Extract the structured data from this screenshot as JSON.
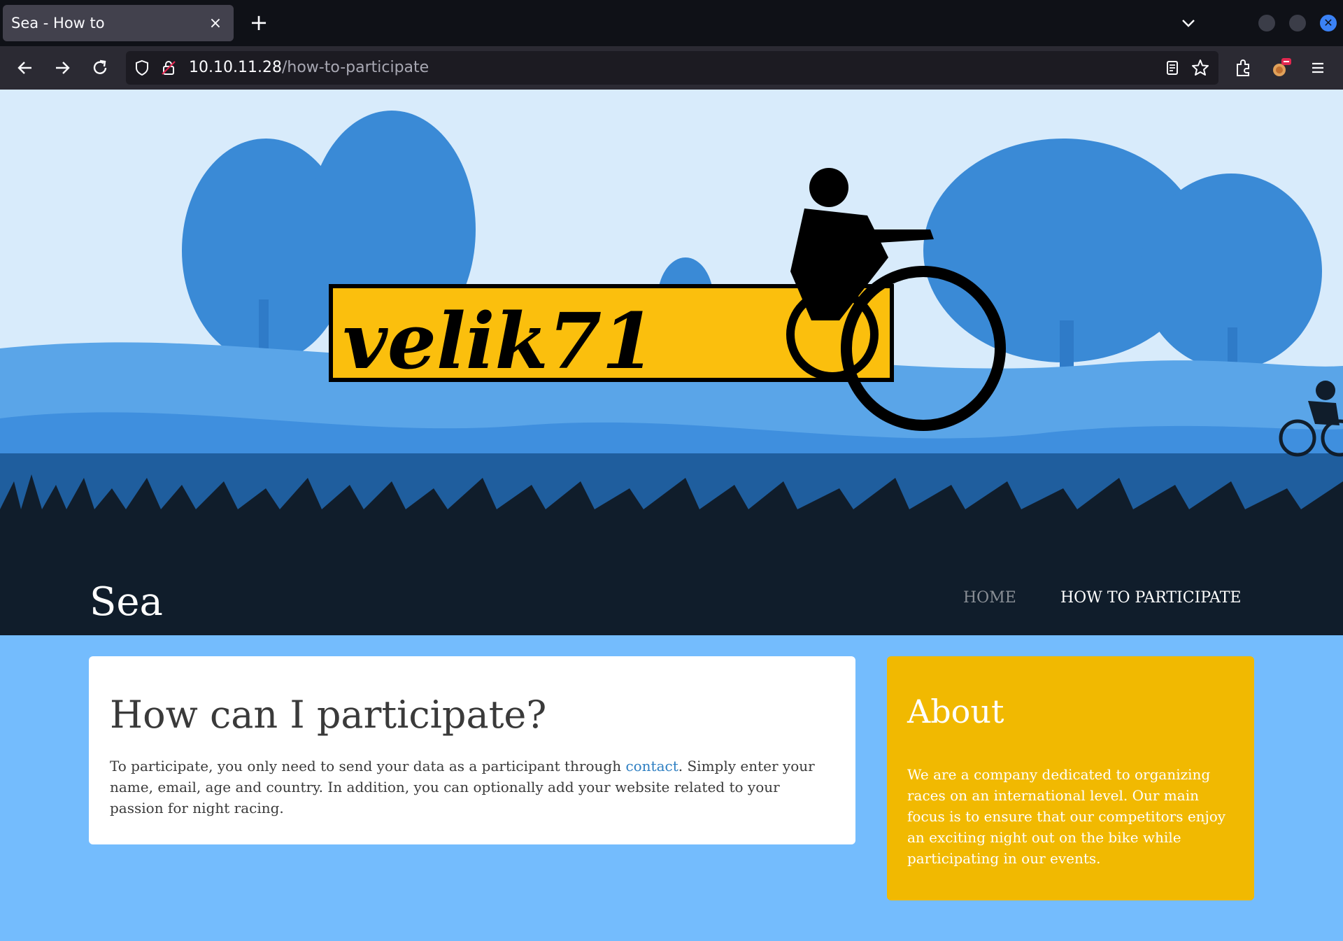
{
  "browser": {
    "tab_title": "Sea - How to",
    "tab_close": "×",
    "new_tab": "+",
    "url_host": "10.10.11.28",
    "url_path": "/how-to-participate"
  },
  "site": {
    "title": "Sea",
    "nav": {
      "home": "HOME",
      "how_to": "HOW TO PARTICIPATE"
    },
    "banner": {
      "logo_text": "velik71"
    }
  },
  "main": {
    "heading": "How can I participate?",
    "body_before": "To participate, you only need to send your data as a participant through ",
    "link_text": "contact",
    "body_after": ". Simply enter your name, email, age and country. In addition, you can optionally add your website related to your passion for night racing."
  },
  "about": {
    "heading": "About",
    "body": "We are a company dedicated to organizing races on an international level. Our main focus is to ensure that our competitors enjoy an exciting night out on the bike while participating in our events."
  },
  "colors": {
    "page_bg": "#74bcfd",
    "header_bg": "#101d2b",
    "about_bg": "#f1b901",
    "link": "#2e7fc2"
  }
}
